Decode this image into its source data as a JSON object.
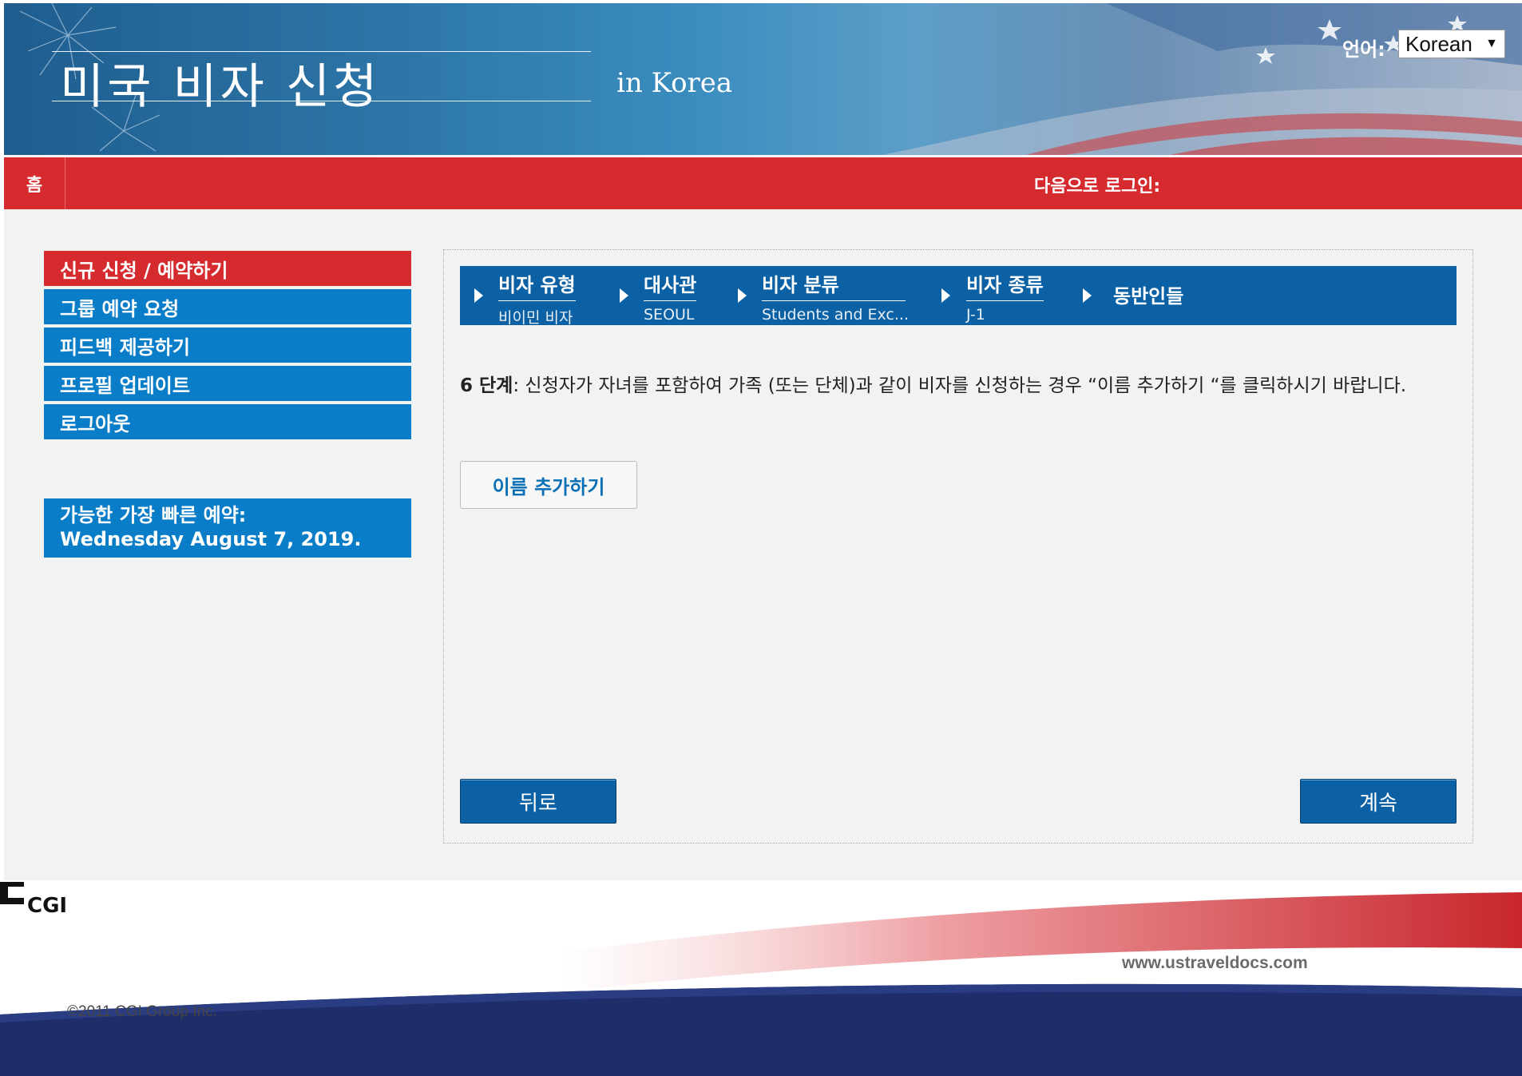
{
  "header": {
    "title": "미국 비자 신청",
    "subtitle": "in Korea",
    "language_label": "언어:",
    "language_selected": "Korean"
  },
  "nav": {
    "home": "홈",
    "login_label": "다음으로 로그인:"
  },
  "sidebar": {
    "items": [
      {
        "label": "신규 신청 / 예약하기",
        "active": true
      },
      {
        "label": "그룹 예약 요청"
      },
      {
        "label": "피드백 제공하기"
      },
      {
        "label": "프로필 업데이트"
      },
      {
        "label": "로그아웃"
      }
    ],
    "earliest_appt_label": "가능한 가장 빠른 예약:",
    "earliest_appt_date": "Wednesday August 7, 2019."
  },
  "steps": [
    {
      "title": "비자 유형",
      "value": "비이민 비자"
    },
    {
      "title": "대사관",
      "value": "SEOUL"
    },
    {
      "title": "비자 분류",
      "value": "Students and Exc..."
    },
    {
      "title": "비자 종류",
      "value": "J-1"
    },
    {
      "title": "동반인들",
      "value": ""
    }
  ],
  "instruction": {
    "step_label": "6 단계",
    "text": ": 신청자가 자녀를 포함하여 가족 (또는 단체)과 같이 비자를 신청하는 경우 “이름 추가하기 “를 클릭하시기 바랍니다."
  },
  "buttons": {
    "add_name": "이름 추가하기",
    "back": "뒤로",
    "continue": "계속"
  },
  "footer": {
    "logo_text": "CGI",
    "copyright": "©2011 CGI Group Inc.",
    "url": "www.ustraveldocs.com"
  },
  "colors": {
    "nav_red": "#d52a2e",
    "primary_blue": "#0b61a4",
    "sidebar_blue": "#0a7dc8"
  }
}
